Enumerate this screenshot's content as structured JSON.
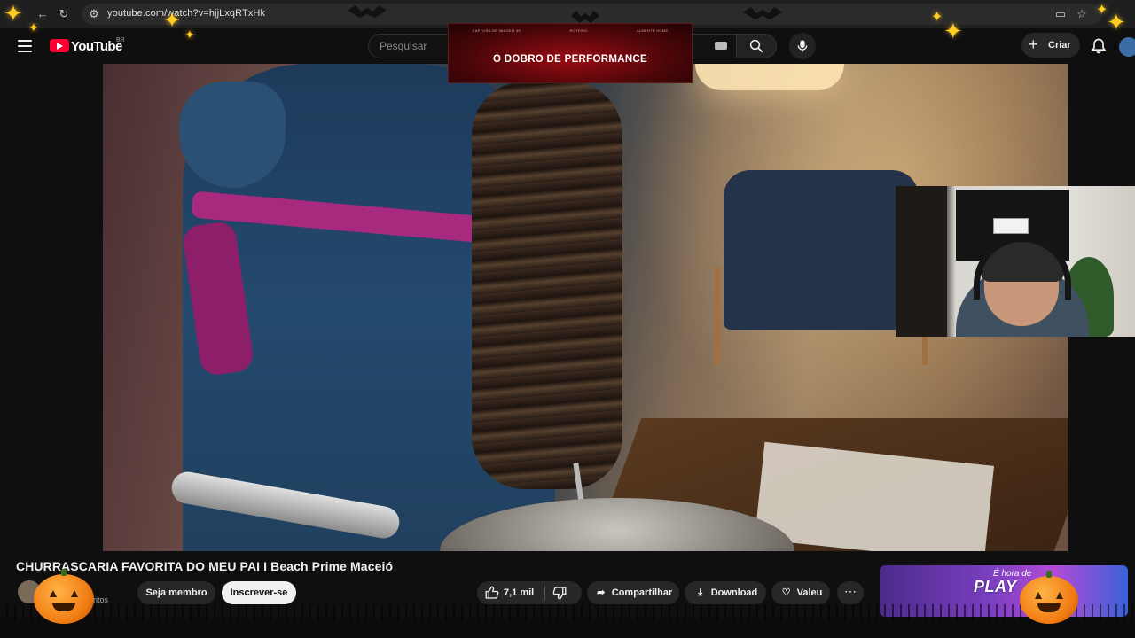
{
  "browser": {
    "url": "youtube.com/watch?v=hjjLxqRTxHk"
  },
  "header": {
    "logo_text": "YouTube",
    "region": "BR",
    "search_placeholder": "Pesquisar",
    "create_label": "Criar"
  },
  "overlay_banner": {
    "top_left": "CAPTURA DE IMAGEM 4K",
    "top_center": "ROTEIRO",
    "top_right": "ALMENTE HOME",
    "title": "O DOBRO DE PERFORMANCE"
  },
  "video": {
    "title": "CHURRASCARIA FAVORITA DO MEU PAI I Beach Prime Maceió",
    "subscribers_label": "scritos"
  },
  "actions": {
    "member_label": "Seja membro",
    "subscribe_label": "Inscrever-se",
    "like_count": "7,1 mil",
    "share_label": "Compartilhar",
    "download_label": "Download",
    "thanks_label": "Valeu",
    "more_glyph": "⋯"
  },
  "ad": {
    "subtitle": "É hora de",
    "headline": "PLAY"
  },
  "colors": {
    "brand": "#ff0033",
    "background": "#0f0f0f",
    "pill": "#272727",
    "accent_banner": "#9a0c14",
    "sparkle": "#ffcc22",
    "pumpkin": "#f07b12"
  },
  "icons": [
    "back-icon",
    "reload-icon",
    "site-settings-icon",
    "cast-icon",
    "bookmark-star-icon",
    "hamburger-icon",
    "search-icon",
    "keyboard-icon",
    "mic-icon",
    "plus-icon",
    "bell-icon",
    "like-icon",
    "dislike-icon",
    "share-icon",
    "download-icon",
    "thanks-icon",
    "more-icon"
  ]
}
